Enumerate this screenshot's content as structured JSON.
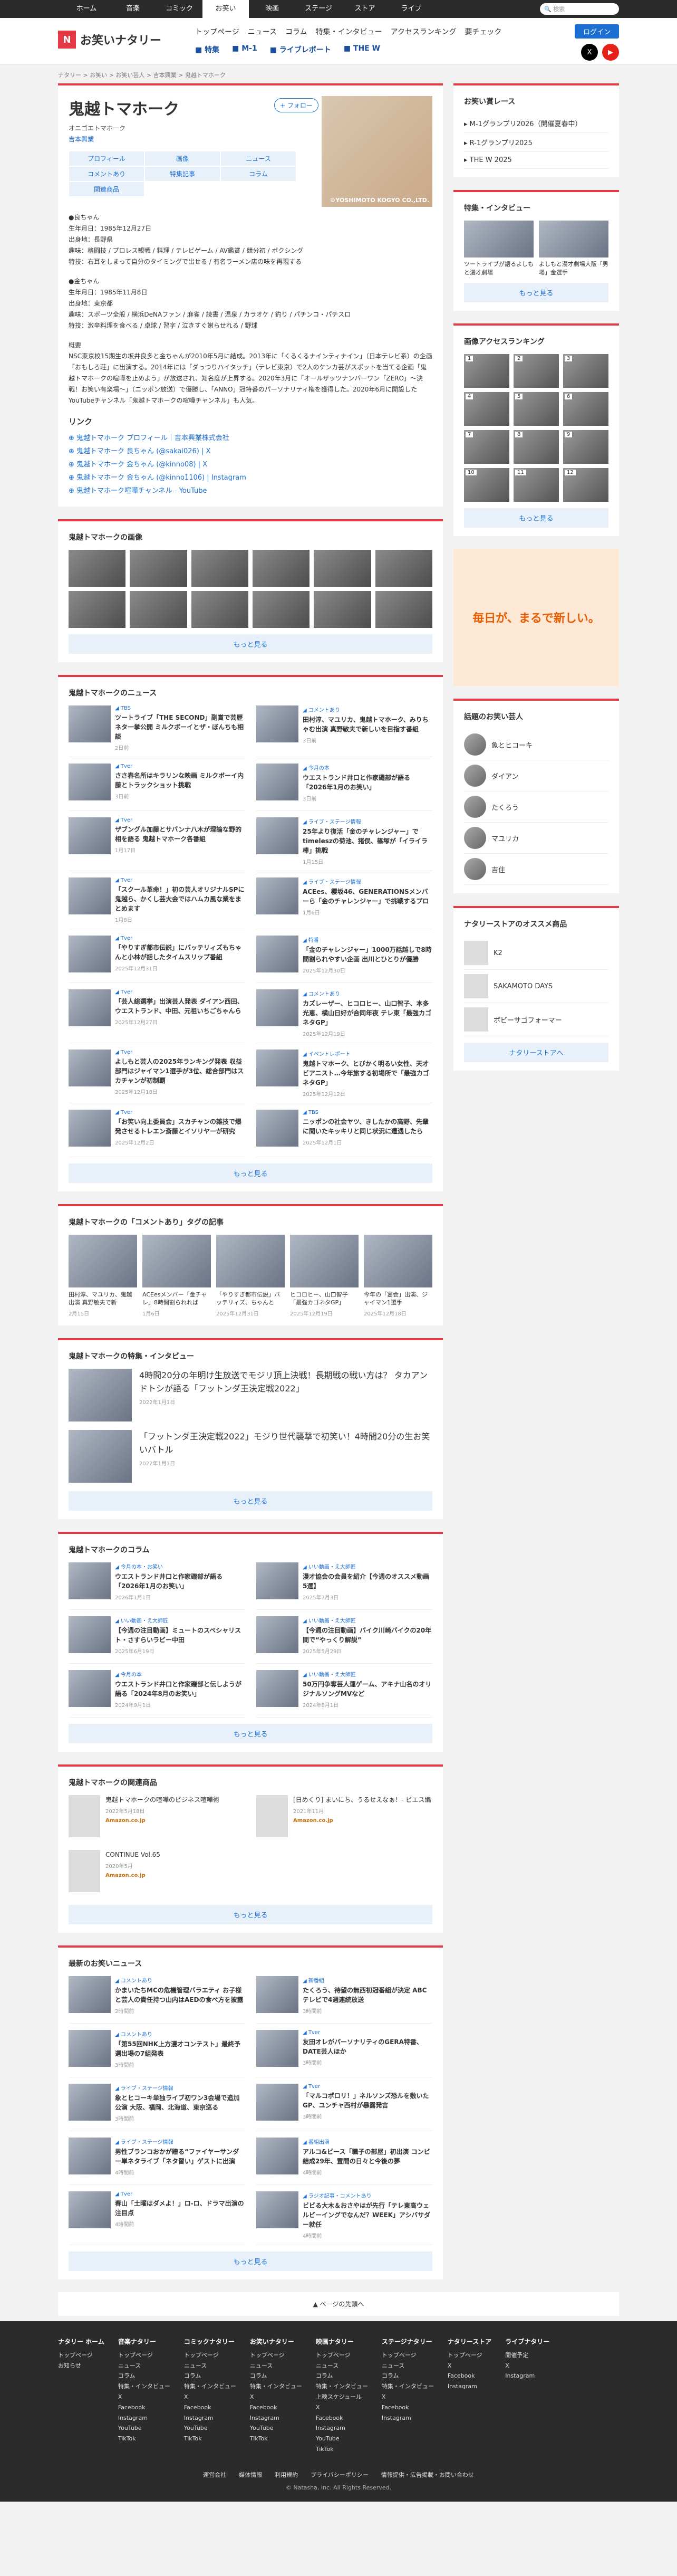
{
  "topbar": {
    "tabs": [
      "ホーム",
      "音楽",
      "コミック",
      "お笑い",
      "映画",
      "ステージ",
      "ストア",
      "ライブ"
    ],
    "active": 3,
    "search_placeholder": "検索"
  },
  "header": {
    "logo": "お笑いナタリー",
    "gnav": [
      "トップページ",
      "ニュース",
      "コラム",
      "特集・インタビュー",
      "アクセスランキング",
      "要チェック"
    ],
    "subnav": [
      "特集",
      "M-1",
      "ライブレポート",
      "THE W"
    ],
    "login": "ログイン"
  },
  "breadcrumb": "ナタリー > お笑い > お笑い芸人 > 吉本興業 > 鬼越トマホーク",
  "profile": {
    "name": "鬼越トマホーク",
    "kana": "オニゴエトマホーク",
    "office": "吉本興業",
    "follow": "+ フォロー",
    "photo_credit": "©YOSHIMOTO KOGYO CO.,LTD.",
    "categories": [
      "プロフィール",
      "画像",
      "ニュース",
      "コメントあり",
      "特集記事",
      "コラム",
      "関連商品"
    ],
    "bio": [
      "●良ちゃん\n生年月日：1985年12月27日\n出身地：長野県\n趣味：格闘技 / プロレス観戦 / 料理 / テレビゲーム / AV鑑賞 / 競分初 / ボクシング\n特技：右耳をしまって自分のタイミングで出せる / 有名ラーメン店の味を再現する",
      "●金ちゃん\n生年月日：1985年11月8日\n出身地：東京都\n趣味：スポーツ全般 / 横浜DeNAファン / 麻雀 / 読書 / 温泉 / カラオケ / 釣り / パチンコ・パチスロ\n特技：激辛料理を食べる / 卓球 / 習字 / 泣きすぐ謝らせれる / 野球",
      "概要\nNSC東京校15期生の坂井良多と金ちゃんが2010年5月に結成。2013年に「くるくるナインティナイン」（日本テレビ系）の企画「おもしろ荘」に出演する。2014年には「ダっつりハイタッチ」（テレビ東京）で2人のケンカ芸がスポットを当てる企画「鬼越トマホークの喧嘩を止めよう」が放送され、知名度が上昇する。2020年3月に「オールザッツナンバーワン「ZERO」〜決戦！お笑い有楽場〜」（ニッポン放送）で優勝し、「ANNO」冠特番のパーソナリティ権を獲得した。2020年6月に開設したYouTubeチャンネル「鬼越トマホークの喧嘩チャンネル」も人気。"
    ],
    "links_title": "リンク",
    "links": [
      "鬼越トマホーク プロフィール｜吉本興業株式会社",
      "鬼越トマホーク 良ちゃん (@sakai026) | X",
      "鬼越トマホーク 金ちゃん (@kinno08) | X",
      "鬼越トマホーク 金ちゃん (@kinno1106) | Instagram",
      "鬼越トマホーク喧嘩チャンネル - YouTube"
    ]
  },
  "images": {
    "title": "鬼越トマホークの画像",
    "more": "もっと見る"
  },
  "news": {
    "title": "鬼越トマホークのニュース",
    "more": "もっと見る",
    "items": [
      {
        "tag": "TBS",
        "title": "ツートライブ「THE SECOND」副賞で芸歴ネタ一挙公開 ミルクボーイとザ・ぼんちも相談",
        "date": "2日前"
      },
      {
        "tag": "コメントあり",
        "title": "田村淳、マユリカ、鬼越トマホーク、みりちゃむ出演 真野敏夫で新しいを目指す番組",
        "date": "3日前"
      },
      {
        "tag": "Tver",
        "title": "ささ春名所はキラリンな映画 ミルクボーイ内藤とトラックショット挑戦",
        "date": "3日前"
      },
      {
        "tag": "今月の本",
        "title": "ウエストランド井口と作家磯部が語る「2026年1月のお笑い」",
        "date": "3日前"
      },
      {
        "tag": "Tver",
        "title": "ザブングル加藤とサバンナ八木が理論な野的相を語る 鬼越トマホーク各番組",
        "date": "1月17日"
      },
      {
        "tag": "ライブ・ステージ情報",
        "title": "25年より復活「金のチャレンジャー」でtimeleszの菊池、猪俣、篠塚が「イライラ棒」挑戦",
        "date": "1月15日"
      },
      {
        "tag": "Tver",
        "title": "「スクール革命！」初の芸人オリジナルSPに鬼越ら、かくし芸大会ではハムカ風な業をまとめます",
        "date": "1月8日"
      },
      {
        "tag": "ライブ・ステージ情報",
        "title": "ACEes、櫻坂46、GENERATIONSメンバーら「金のチャレンジャー」で挑戦するプロ",
        "date": "1月6日"
      },
      {
        "tag": "Tver",
        "title": "「やりすぎ都市伝説」にバッテリィズもちゃんと小林が話したタイムスリップ番組",
        "date": "2025年12月31日"
      },
      {
        "tag": "特番",
        "title": "「金のチャレンジャー」1000万話越しで8時間割られやすい企画 出川とひとりが優勝",
        "date": "2025年12月30日"
      },
      {
        "tag": "Tver",
        "title": "「芸人総選挙」出演芸人発表 ダイアン西田、ウエストランド、中田、元祖いちごちゃんら",
        "date": "2025年12月27日"
      },
      {
        "tag": "コメントあり",
        "title": "カズレーザー、ヒコロヒー、山口智子、本多光恵、横山日好が合同年夜 テレ東「最強カゴネタGP」",
        "date": "2025年12月19日"
      },
      {
        "tag": "Tver",
        "title": "よしもと芸人の2025年ランキング発表 収益部門はジャイマン1選手が3位、総合部門はスカチャンが初制覇",
        "date": "2025年12月18日"
      },
      {
        "tag": "イベントレポート",
        "title": "鬼越トマホーク、とびかく明るい女性、天才ビアニスト…今年旅する初場所で「最強カゴネタGP」",
        "date": "2025年12月12日"
      },
      {
        "tag": "Tver",
        "title": "「お笑い向上委員会」スカチャンの雑技で爆発させるトレエン斎藤とイソリヤーが研究",
        "date": "2025年12月2日"
      },
      {
        "tag": "TBS",
        "title": "ニッポンの社会ヤツ、きしたかの高野、先輩に聞いたキッキリと同じ状況に遭遇したら",
        "date": "2025年12月1日"
      }
    ]
  },
  "tagged": {
    "title": "鬼越トマホークの「コメントあり」タグの記事",
    "items": [
      {
        "cap": "田村淳、マユリカ、鬼越出演 真野敏夫で新",
        "date": "2月15日"
      },
      {
        "cap": "ACEesメンバー「金チャレ」8時間割られれば",
        "date": "1月6日"
      },
      {
        "cap": "「やりすぎ都市伝説」バッテリィズ、ちゃんと",
        "date": "2025年12月31日"
      },
      {
        "cap": "ヒコロヒー、山口智子「最強カゴネタGP」",
        "date": "2025年12月19日"
      },
      {
        "cap": "今年の「宴会」出演、ジャイマン1選手",
        "date": "2025年12月18日"
      }
    ]
  },
  "features": {
    "title": "鬼越トマホークの特集・インタビュー",
    "more": "もっと見る",
    "items": [
      {
        "title": "4時間20分の年明け生放送でモジリ頂上決戦！長期戦の戦い方は？ タカアンドトシが語る「フットンダ王決定戦2022」",
        "date": "2022年1月1日"
      },
      {
        "title": "「フットンダ王決定戦2022」モジり世代襲撃で初笑い！4時間20分の生お笑いバトル",
        "date": "2022年1月1日"
      }
    ]
  },
  "columns": {
    "title": "鬼越トマホークのコラム",
    "more": "もっと見る",
    "items": [
      {
        "tag": "今月の本・お笑い",
        "title": "ウエストランド井口と作家磯部が語る「2026年1月のお笑い」",
        "date": "2026年1月1日"
      },
      {
        "tag": "いい動画・え大師匠",
        "title": "漫才協会の会員を紹介【今週のオススメ動画5選】",
        "date": "2025年7月3日"
      },
      {
        "tag": "いい動画・え大師匠",
        "title": "【今週の注目動画】ミュートのスペシャリスト・さすらいラビー中田",
        "date": "2025年6月19日"
      },
      {
        "tag": "いい動画・え大師匠",
        "title": "【今週の注目動画】バイク川崎バイクの20年間で“やっくり解説”",
        "date": "2025年5月29日"
      },
      {
        "tag": "今月の本",
        "title": "ウエストランド井口と作家磯部と伝しようが語る「2024年8月のお笑い」",
        "date": "2024年9月1日"
      },
      {
        "tag": "いい動画・え大師匠",
        "title": "50万円争奪芸人運ゲーム、アキナ山名のオリジナルソングMVなど",
        "date": "2024年8月1日"
      }
    ]
  },
  "products": {
    "title": "鬼越トマホークの関連商品",
    "more": "もっと見る",
    "items": [
      {
        "title": "鬼越トマホークの喧嘩のビジネス喧嘩術",
        "date": "2022年5月18日",
        "shop": "Amazon.co.jp"
      },
      {
        "title": "[日めくり] まいにち、うるせえなぁ！- ビエス編",
        "date": "2021年11月",
        "shop": "Amazon.co.jp"
      },
      {
        "title": "CONTINUE Vol.65",
        "date": "2020年5月",
        "shop": "Amazon.co.jp"
      }
    ]
  },
  "latest": {
    "title": "最新のお笑いニュース",
    "more": "もっと見る",
    "items": [
      {
        "tag": "コメントあり",
        "title": "かまいたちMCの危機管理バラエティ お子様と芸人の責任持つ山内はAEDの食べ方を披露",
        "date": "2時間前"
      },
      {
        "tag": "新番組",
        "title": "たくろう、待望の無西初冠番組が決定 ABCテレビで4週連続放送",
        "date": "3時間前"
      },
      {
        "tag": "コメントあり",
        "title": "「第55回NHK上方漫才コンテスト」最終予選出場の7組発表",
        "date": "3時間前"
      },
      {
        "tag": "Tver",
        "title": "友田オレがパーソナリティのGERA特番、DATE芸人ほか",
        "date": "3時間前"
      },
      {
        "tag": "ライブ・ステージ情報",
        "title": "象とヒコーキ単独ライブ初ワン3会場で追加公演 大阪、福岡、北海道、東京巡る",
        "date": "3時間前"
      },
      {
        "tag": "Tver",
        "title": "「マルコポロリ！」ネルソンズ恐ルを敷いたGP、ユンチャ西村が暴露発言",
        "date": "3時間前"
      },
      {
        "tag": "ライブ・ステージ情報",
        "title": "男性ブランコおかが贈る“ファイヤーサンダー単ネタライブ「ネタ習い」ゲストに出演",
        "date": "4時間前"
      },
      {
        "tag": "番組出演",
        "title": "アルコ&ピース「職子の部屋」初出演 コンビ結成29年、置間の日々と今後の夢",
        "date": "4時間前"
      },
      {
        "tag": "Tver",
        "title": "春山「土曜はダメよ！」ロ-ロ、ドラマ出演の注目点",
        "date": "4時間前"
      },
      {
        "tag": "ラジオ記事・コメントあり",
        "title": "ビビる大木＆おさやはが先行「テレ東高ウェルビーイングでなんだ？WEEK」アシバサダー就任",
        "date": "4時間前"
      }
    ]
  },
  "side": {
    "follow_title": "お笑い賞レース",
    "follow_items": [
      "M-1グランプリ2026（開催夏春中）",
      "R-1グランプリ2025",
      "THE W 2025"
    ],
    "feature_title": "特集・インタビュー",
    "feature_items": [
      {
        "cap": "ツートライブが語るよしもと漫才劇場"
      },
      {
        "cap": "よしもと漫才劇場大阪「男場」金選手"
      }
    ],
    "rank_title": "画像アクセスランキング",
    "ranks": [
      "1",
      "2",
      "3",
      "4",
      "5",
      "6",
      "7",
      "8",
      "9",
      "10",
      "11",
      "12"
    ],
    "more": "もっと見る",
    "ad_text": "毎日が、まるで新しい。",
    "people_title": "話題のお笑い芸人",
    "people": [
      "象とヒコーキ",
      "ダイアン",
      "たくろう",
      "マユリカ",
      "吉住"
    ],
    "store_title": "ナタリーストアのオススメ商品",
    "store": [
      "K2",
      "SAKAMOTO DAYS",
      "ボビーサゴフォーマー"
    ],
    "store_more": "ナタリーストアへ"
  },
  "pagetop": "ページの先頭へ",
  "footer": {
    "cols": [
      {
        "h": "ナタリー ホーム",
        "items": [
          "トップページ",
          "お知らせ"
        ]
      },
      {
        "h": "音楽ナタリー",
        "items": [
          "トップページ",
          "ニュース",
          "コラム",
          "特集・インタビュー",
          "X",
          "Facebook",
          "Instagram",
          "YouTube",
          "TikTok"
        ]
      },
      {
        "h": "コミックナタリー",
        "items": [
          "トップページ",
          "ニュース",
          "コラム",
          "特集・インタビュー",
          "X",
          "Facebook",
          "Instagram",
          "YouTube",
          "TikTok"
        ]
      },
      {
        "h": "お笑いナタリー",
        "items": [
          "トップページ",
          "ニュース",
          "コラム",
          "特集・インタビュー",
          "X",
          "Facebook",
          "Instagram",
          "YouTube",
          "TikTok"
        ]
      },
      {
        "h": "映画ナタリー",
        "items": [
          "トップページ",
          "ニュース",
          "コラム",
          "特集・インタビュー",
          "上映スケジュール",
          "X",
          "Facebook",
          "Instagram",
          "YouTube",
          "TikTok"
        ]
      },
      {
        "h": "ステージナタリー",
        "items": [
          "トップページ",
          "ニュース",
          "コラム",
          "特集・インタビュー",
          "X",
          "Facebook",
          "Instagram"
        ]
      },
      {
        "h": "ナタリーストア",
        "items": [
          "トップページ",
          "X",
          "Facebook",
          "Instagram"
        ]
      },
      {
        "h": "ライブナタリー",
        "items": [
          "開催予定",
          "X",
          "Instagram"
        ]
      }
    ],
    "links": [
      "運営会社",
      "媒体情報",
      "利用規約",
      "プライバシーポリシー",
      "情報提供・広告掲載・お問い合わせ"
    ],
    "copy": "© Natasha, Inc. All Rights Reserved."
  }
}
